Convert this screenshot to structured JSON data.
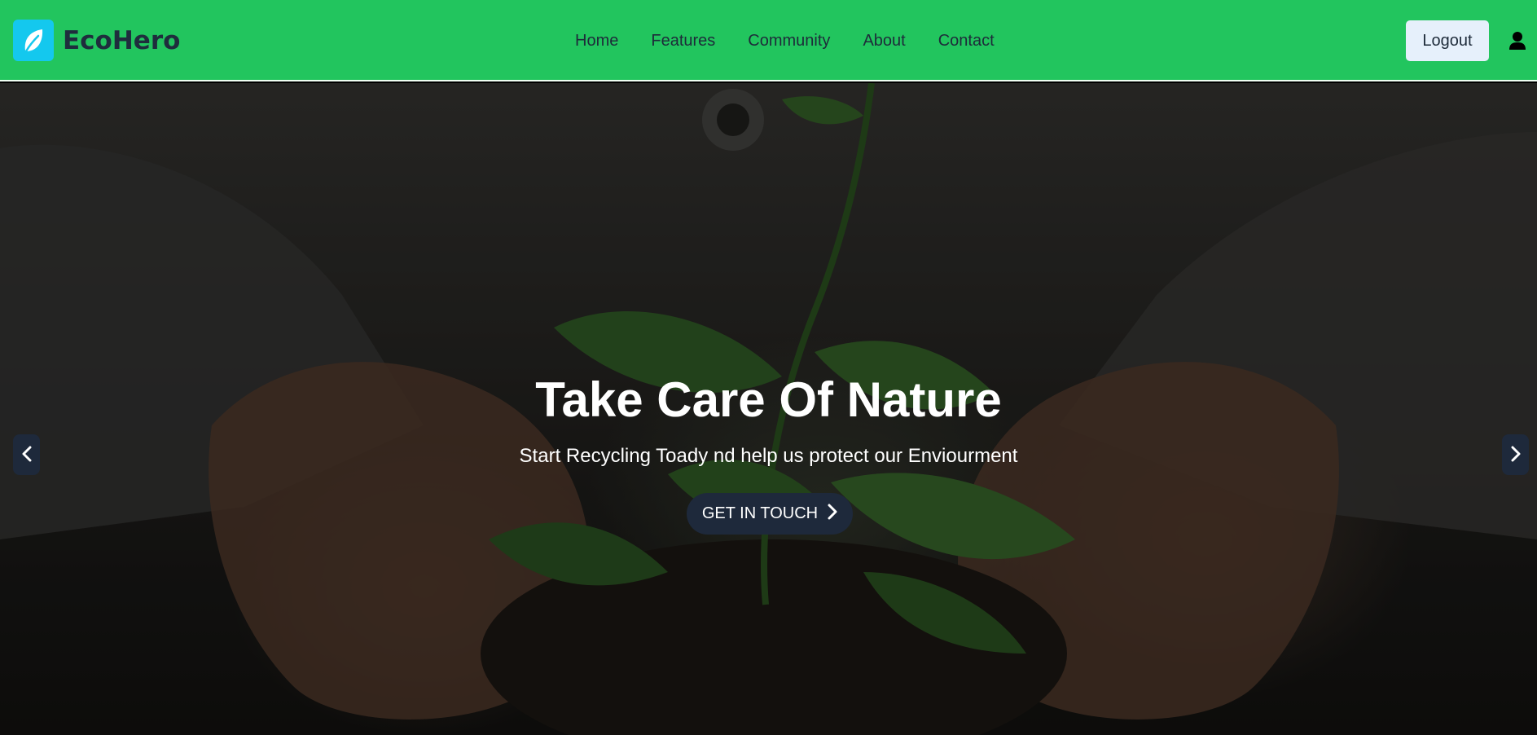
{
  "header": {
    "brand_name": "EcoHero",
    "brand_icon": "leaf-icon",
    "nav": [
      {
        "label": "Home"
      },
      {
        "label": "Features"
      },
      {
        "label": "Community"
      },
      {
        "label": "About"
      },
      {
        "label": "Contact"
      }
    ],
    "logout_label": "Logout",
    "user_icon": "user-icon"
  },
  "hero": {
    "title": "Take Care Of Nature",
    "subtitle": "Start Recycling Toady nd help us protect our Enviourment",
    "cta_label": "GET IN TOUCH",
    "cta_icon": "chevron-right-icon",
    "prev_icon": "chevron-left-icon",
    "next_icon": "chevron-right-icon"
  },
  "colors": {
    "navbar": "#22c55e",
    "brand_icon_bg": "#14c8ee",
    "button_dark": "#1e293b",
    "logout_bg": "#e6f0fb"
  }
}
